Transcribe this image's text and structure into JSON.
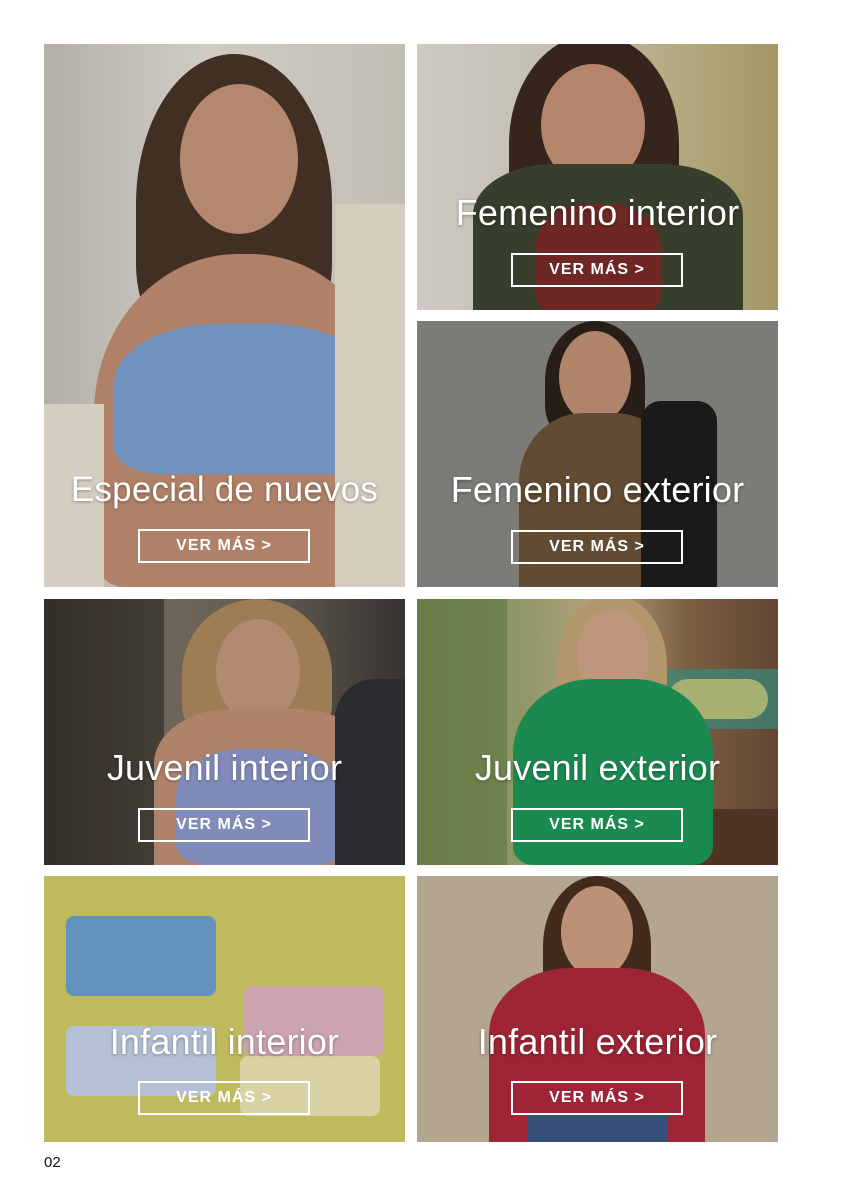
{
  "tiles": [
    {
      "title": "Especial de nuevos",
      "cta": "VER MÁS >"
    },
    {
      "title": "Femenino interior",
      "cta": "VER MÁS >"
    },
    {
      "title": "Femenino exterior",
      "cta": "VER MÁS >"
    },
    {
      "title": "Juvenil interior",
      "cta": "VER MÁS >"
    },
    {
      "title": "Juvenil exterior",
      "cta": "VER MÁS >"
    },
    {
      "title": "Infantil interior",
      "cta": "VER MÁS >"
    },
    {
      "title": "Infantil exterior",
      "cta": "VER MÁS >"
    }
  ],
  "page_number": "02"
}
